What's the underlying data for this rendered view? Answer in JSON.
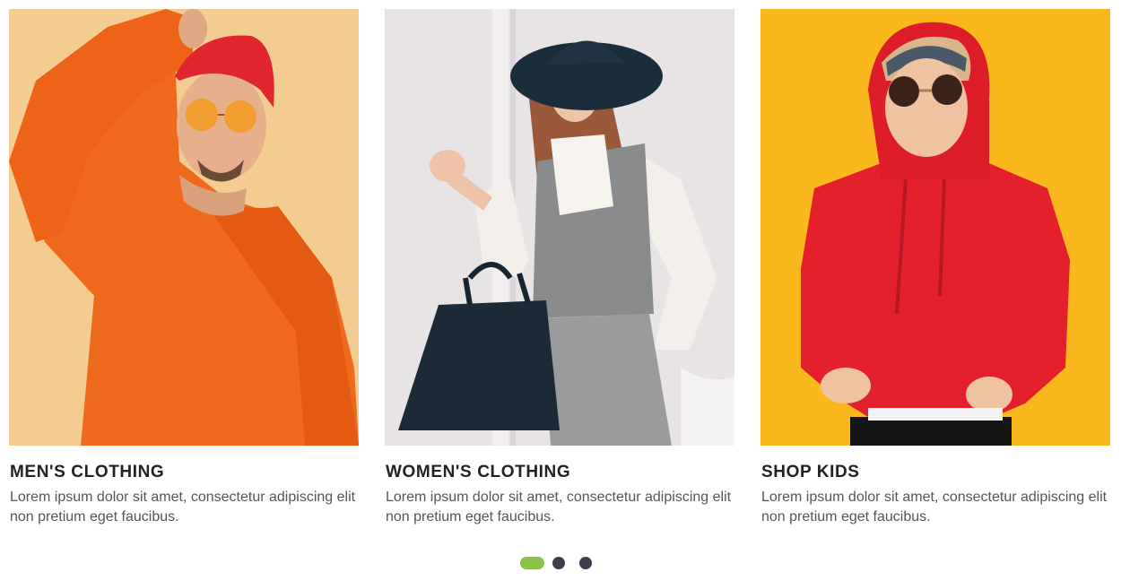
{
  "cards": [
    {
      "title": "MEN'S CLOTHING",
      "description": "Lorem ipsum dolor sit amet, consectetur adipiscing elit non pretium eget faucibus.",
      "image": "man-orange-sweatshirt-photo"
    },
    {
      "title": "WOMEN'S CLOTHING",
      "description": "Lorem ipsum dolor sit amet, consectetur adipiscing elit non pretium eget faucibus.",
      "image": "woman-hat-handbag-photo"
    },
    {
      "title": "SHOP KIDS",
      "description": "Lorem ipsum dolor sit amet, consectetur adipiscing elit non pretium eget faucibus.",
      "image": "kid-red-hoodie-photo"
    }
  ],
  "pagination": {
    "count": 3,
    "active_index": 0
  },
  "colors": {
    "title": "#222222",
    "text": "#555555",
    "dot_active": "#8bc34a",
    "dot_inactive": "#3a3f4b"
  }
}
